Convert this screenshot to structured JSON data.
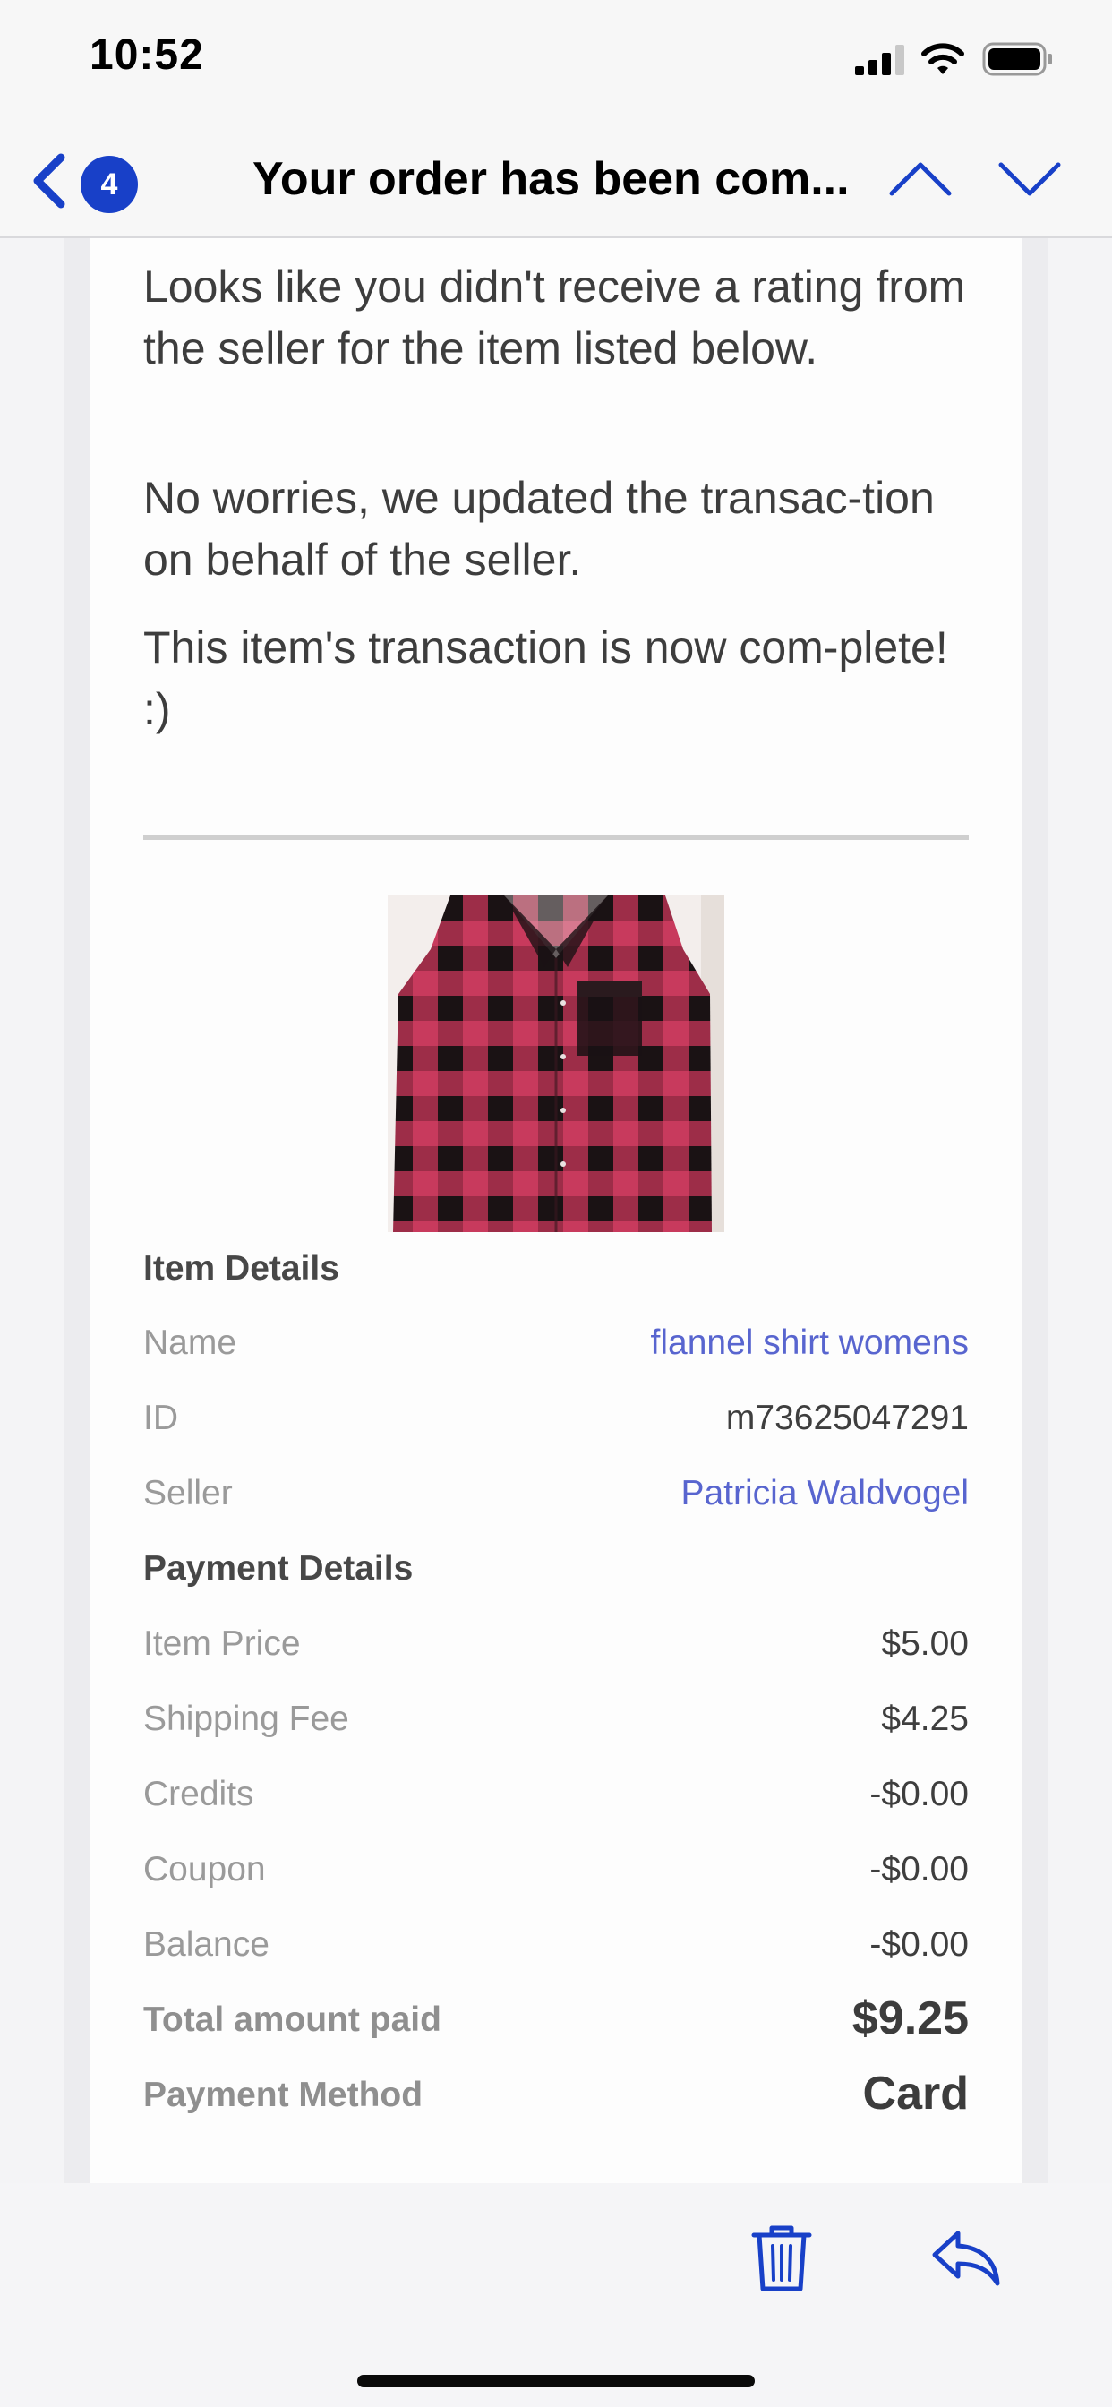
{
  "status_bar": {
    "time": "10:52",
    "icons": [
      "signal-icon",
      "wifi-icon",
      "battery-icon"
    ]
  },
  "nav": {
    "back_icon": "chevron-left-icon",
    "unread_count": "4",
    "title": "Your order has been com...",
    "prev_icon": "chevron-up-icon",
    "next_icon": "chevron-down-icon"
  },
  "message": {
    "paragraph_1": "Looks like you didn't receive a rating from the seller for the item listed below.",
    "paragraph_2": "No worries, we updated the transac-tion on behalf of the seller.",
    "paragraph_3": "This item's transaction is now com-plete! :)"
  },
  "item_details": {
    "title": "Item Details",
    "name_label": "Name",
    "name_value": "flannel shirt womens",
    "id_label": "ID",
    "id_value": "m73625047291",
    "seller_label": "Seller",
    "seller_value": "Patricia Waldvogel"
  },
  "payment_details": {
    "title": "Payment Details",
    "item_price_label": "Item Price",
    "item_price_value": "$5.00",
    "shipping_label": "Shipping Fee",
    "shipping_value": "$4.25",
    "credits_label": "Credits",
    "credits_value": "-$0.00",
    "coupon_label": "Coupon",
    "coupon_value": "-$0.00",
    "balance_label": "Balance",
    "balance_value": "-$0.00",
    "total_label": "Total amount paid",
    "total_value": "$9.25",
    "method_label": "Payment Method",
    "method_value": "Card"
  },
  "toolbar": {
    "trash_icon": "trash-icon",
    "reply_icon": "reply-icon"
  },
  "colors": {
    "accent": "#1840c8",
    "link": "#5865cf",
    "flannel_red": "#c23a5a",
    "flannel_black": "#1a1214"
  }
}
